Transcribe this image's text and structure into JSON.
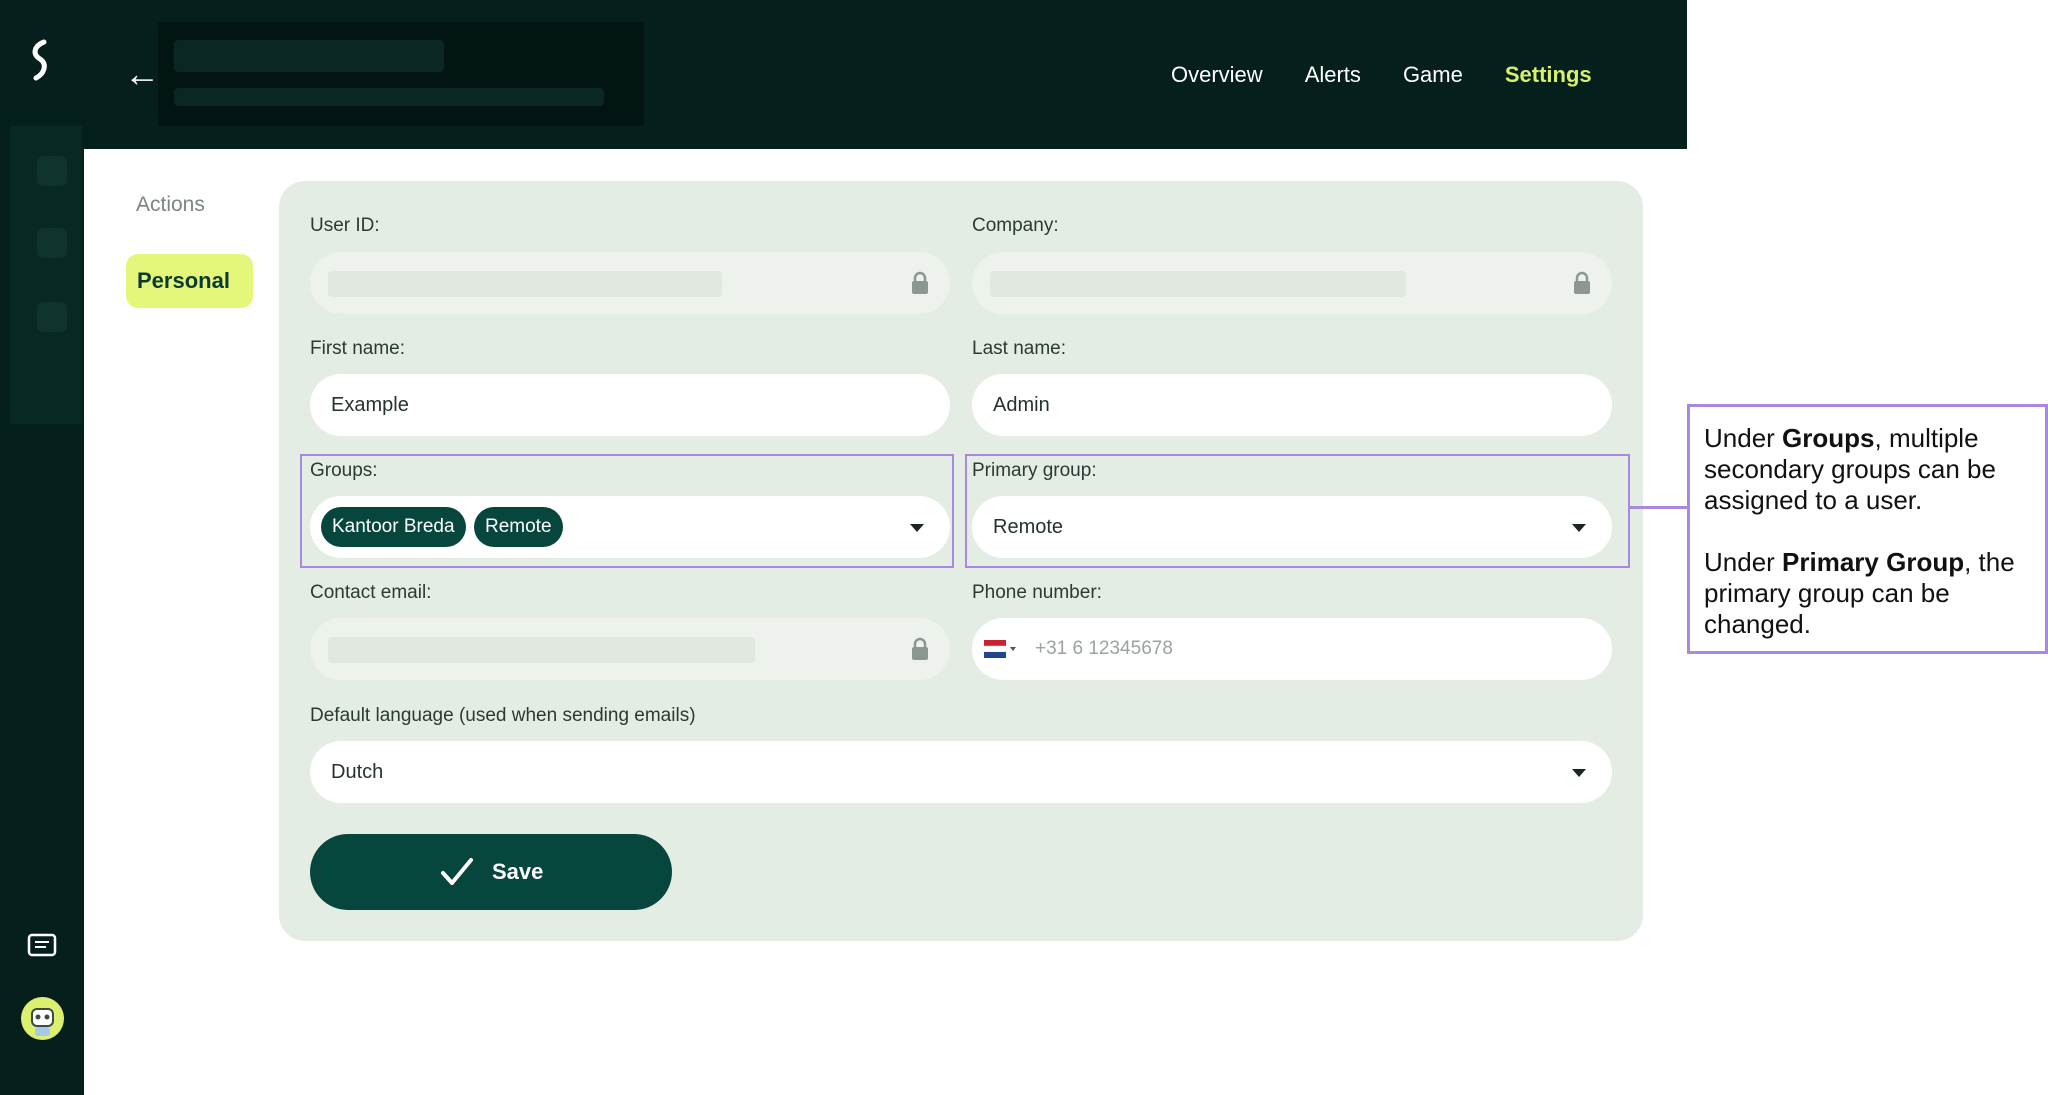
{
  "header": {
    "nav": [
      {
        "label": "Overview",
        "active": false
      },
      {
        "label": "Alerts",
        "active": false
      },
      {
        "label": "Game",
        "active": false
      },
      {
        "label": "Settings",
        "active": true
      }
    ]
  },
  "sidebar": {
    "actions_label": "Actions",
    "personal_label": "Personal"
  },
  "form": {
    "user_id_label": "User ID:",
    "company_label": "Company:",
    "first_name_label": "First name:",
    "first_name_value": "Example",
    "last_name_label": "Last name:",
    "last_name_value": "Admin",
    "groups_label": "Groups:",
    "groups_chips": [
      "Kantoor Breda",
      "Remote"
    ],
    "primary_group_label": "Primary group:",
    "primary_group_value": "Remote",
    "contact_email_label": "Contact email:",
    "phone_label": "Phone number:",
    "phone_placeholder": "+31 6 12345678",
    "language_label": "Default language (used when sending emails)",
    "language_value": "Dutch",
    "save_label": "Save"
  },
  "annotation": {
    "p1_before": "Under ",
    "p1_bold": "Groups",
    "p1_after": ", multiple secondary groups can be assigned to a user.",
    "p2_before": "Under ",
    "p2_bold": "Primary Group",
    "p2_after": ", the primary group can be changed."
  },
  "colors": {
    "dark_green": "#05201c",
    "accent_lime": "#e4f77a",
    "button_green": "#07463c",
    "card_bg": "#e4ede3",
    "highlight": "#a888e0"
  }
}
